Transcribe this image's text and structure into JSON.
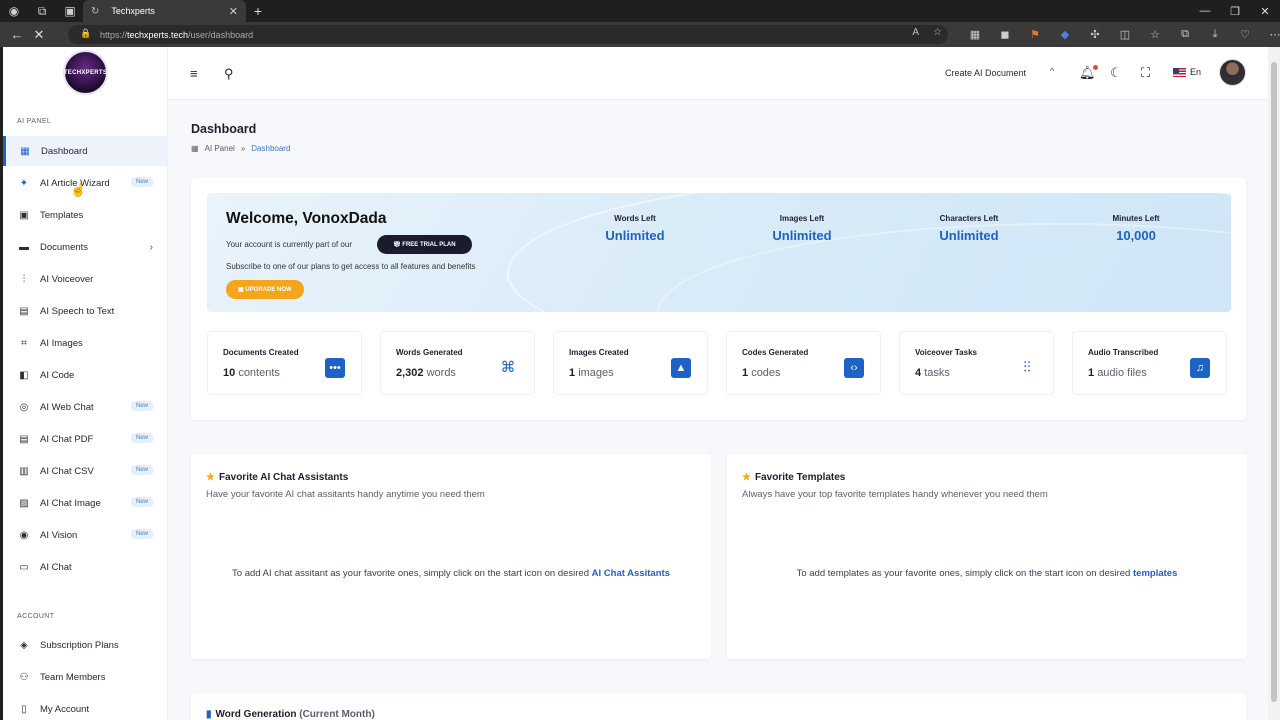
{
  "browser": {
    "tab_title": "Techxperts",
    "url_prefix": "https://",
    "url_host": "techxperts.tech",
    "url_path": "/user/dashboard"
  },
  "sidebar": {
    "logo_text": "TECHXPERTS",
    "ai_panel_label": "AI PANEL",
    "items": [
      {
        "label": "Dashboard",
        "icon": "grid-icon"
      },
      {
        "label": "AI Article Wizard",
        "icon": "sparkle-icon",
        "badge": "New"
      },
      {
        "label": "Templates",
        "icon": "ai-chip-icon"
      },
      {
        "label": "Documents",
        "icon": "folder-icon",
        "chevron": "›"
      },
      {
        "label": "AI Voiceover",
        "icon": "waveform-icon"
      },
      {
        "label": "AI Speech to Text",
        "icon": "file-audio-icon"
      },
      {
        "label": "AI Images",
        "icon": "image-scan-icon"
      },
      {
        "label": "AI Code",
        "icon": "code-icon"
      },
      {
        "label": "AI Web Chat",
        "icon": "globe-icon",
        "badge": "New"
      },
      {
        "label": "AI Chat PDF",
        "icon": "pdf-icon",
        "badge": "New"
      },
      {
        "label": "AI Chat CSV",
        "icon": "csv-icon",
        "badge": "New"
      },
      {
        "label": "AI Chat Image",
        "icon": "image-icon",
        "badge": "New"
      },
      {
        "label": "AI Vision",
        "icon": "vision-icon",
        "badge": "New"
      },
      {
        "label": "AI Chat",
        "icon": "chat-icon"
      }
    ],
    "account_label": "ACCOUNT",
    "account_items": [
      {
        "label": "Subscription Plans",
        "icon": "plans-icon"
      },
      {
        "label": "Team Members",
        "icon": "team-icon"
      },
      {
        "label": "My Account",
        "icon": "user-icon"
      }
    ]
  },
  "topbar": {
    "create_doc": "Create AI Document",
    "lang": "En"
  },
  "page": {
    "title": "Dashboard",
    "crumb_root": "AI Panel",
    "crumb_sep": "»",
    "crumb_current": "Dashboard"
  },
  "welcome": {
    "greeting": "Welcome, VonoxDada",
    "account_text": "Your account is currently part of our",
    "plan_badge": "FREE TRIAL PLAN",
    "subscribe_text": "Subscribe to one of our plans to get access to all features and benefits",
    "upgrade_label": "UPGRADE NOW",
    "stats": [
      {
        "label": "Words Left",
        "value": "Unlimited"
      },
      {
        "label": "Images Left",
        "value": "Unlimited"
      },
      {
        "label": "Characters Left",
        "value": "Unlimited"
      },
      {
        "label": "Minutes Left",
        "value": "10,000"
      }
    ]
  },
  "metrics": [
    {
      "label": "Documents Created",
      "count": "10",
      "unit": "contents",
      "icon": "folder-dots-icon"
    },
    {
      "label": "Words Generated",
      "count": "2,302",
      "unit": "words",
      "icon": "ai-chip-icon"
    },
    {
      "label": "Images Created",
      "count": "1",
      "unit": "images",
      "icon": "image-icon"
    },
    {
      "label": "Codes Generated",
      "count": "1",
      "unit": "codes",
      "icon": "code-icon"
    },
    {
      "label": "Voiceover Tasks",
      "count": "4",
      "unit": "tasks",
      "icon": "waveform-icon"
    },
    {
      "label": "Audio Transcribed",
      "count": "1",
      "unit": "audio files",
      "icon": "music-file-icon"
    }
  ],
  "favorites": {
    "assistants": {
      "title": "Favorite AI Chat Assistants",
      "subtitle": "Have your favorite AI chat assitants handy anytime you need them",
      "message": "To add AI chat assitant as your favorite ones, simply click on the start icon on desired",
      "link": "AI Chat Assitants"
    },
    "templates": {
      "title": "Favorite Templates",
      "subtitle": "Always have your top favorite templates handy whenever you need them",
      "message": "To add templates as your favorite ones, simply click on the start icon on desired",
      "link": "templates"
    }
  },
  "word_generation": {
    "title": "Word Generation",
    "period": "(Current Month)"
  }
}
